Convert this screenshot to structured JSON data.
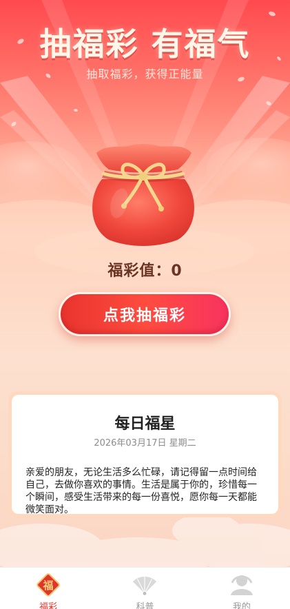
{
  "header": {
    "title": "抽福彩 有福气",
    "subtitle": "抽取福彩，获得正能量"
  },
  "lucky_bag": {
    "icon": "red-lucky-bag-icon"
  },
  "score": {
    "label": "福彩值：",
    "value": "0"
  },
  "draw_button": {
    "label": "点我抽福彩"
  },
  "daily_card": {
    "title": "每日福星",
    "date": "2026年03月17日",
    "weekday": "星期二",
    "message": "亲爱的朋友，无论生活多么忙碌，请记得留一点时间给自己，去做你喜欢的事情。生活是属于你的，珍惜每一个瞬间，感受生活带来的每一份喜悦，愿你每一天都能微笑面对。"
  },
  "tabbar": {
    "items": [
      {
        "label": "福彩",
        "icon": "fu-diamond-icon",
        "active": true
      },
      {
        "label": "科普",
        "icon": "fan-icon",
        "active": false
      },
      {
        "label": "我的",
        "icon": "profile-icon",
        "active": false
      }
    ],
    "fu_char": "福"
  },
  "colors": {
    "primary_red": "#e8342e",
    "active_tab": "#e0352c",
    "inactive_tab": "#999999",
    "score_text": "#6a3324"
  }
}
